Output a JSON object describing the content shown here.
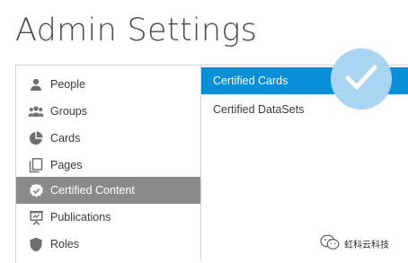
{
  "page": {
    "title": "Admin Settings"
  },
  "sidebar": {
    "items": [
      {
        "label": "People",
        "icon": "person-icon"
      },
      {
        "label": "Groups",
        "icon": "groups-icon"
      },
      {
        "label": "Cards",
        "icon": "pie-chart-icon"
      },
      {
        "label": "Pages",
        "icon": "pages-icon"
      },
      {
        "label": "Certified Content",
        "icon": "certified-badge-icon",
        "active": true
      },
      {
        "label": "Publications",
        "icon": "presentation-board-icon"
      },
      {
        "label": "Roles",
        "icon": "shield-icon"
      }
    ]
  },
  "content": {
    "items": [
      {
        "label": "Certified Cards",
        "active": true
      },
      {
        "label": "Certified DataSets"
      }
    ]
  },
  "overlay": {
    "icon": "checkmark-icon"
  },
  "watermark": {
    "text": "虹科云科技"
  },
  "colors": {
    "active_blue": "#0a8fd6",
    "active_gray": "#8a8a8a",
    "badge": "#a9d4f2"
  }
}
